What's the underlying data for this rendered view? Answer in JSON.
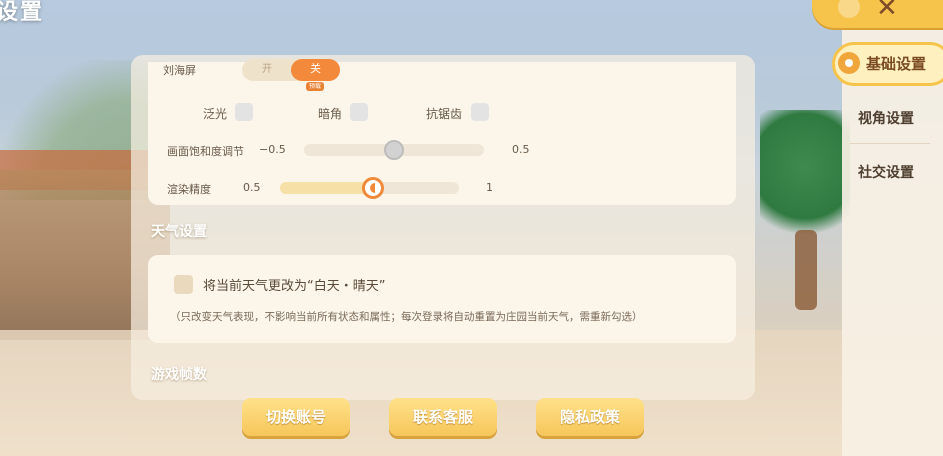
{
  "page": {
    "title": "设置"
  },
  "display": {
    "notch_label": "刘海屏",
    "notch_toggle": {
      "on_label": "开",
      "off_label": "关",
      "selected": "关",
      "tag": "预载"
    },
    "effects": [
      {
        "label": "泛光",
        "checked": false
      },
      {
        "label": "暗角",
        "checked": false
      },
      {
        "label": "抗锯齿",
        "checked": false
      }
    ],
    "saturation": {
      "label": "画面饱和度调节",
      "min_label": "−0.5",
      "max_label": "0.5",
      "min": -0.5,
      "max": 0.5,
      "value": 0.0
    },
    "render_precision": {
      "label": "渲染精度",
      "min_label": "0.5",
      "max_label": "1",
      "min": 0.5,
      "max": 1,
      "value": 0.76
    }
  },
  "weather": {
    "section_title": "天气设置",
    "checkbox_label": "将当前天气更改为“白天・晴天”",
    "checked": false,
    "note": "（只改变天气表现，不影响当前所有状态和属性；每次登录将自动重置为庄园当前天气，需重新勾选）"
  },
  "framerate": {
    "section_title": "游戏帧数"
  },
  "buttons": {
    "switch_account": "切换账号",
    "contact_support": "联系客服",
    "privacy_policy": "隐私政策"
  },
  "sidebar": {
    "tabs": [
      {
        "label": "基础设置",
        "active": true,
        "icon": "paw-icon"
      },
      {
        "label": "视角设置",
        "active": false
      },
      {
        "label": "社交设置",
        "active": false
      }
    ],
    "close_icon": "close-icon"
  },
  "colors": {
    "accent": "#f38a3b",
    "button": "#f6c65a",
    "panel": "#fbf5ea",
    "tab_highlight": "#f6c44a"
  }
}
